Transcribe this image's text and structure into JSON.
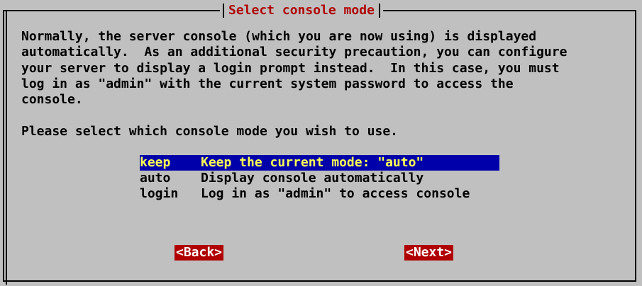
{
  "dialog": {
    "title": "Select console mode",
    "description_lines": [
      "Normally, the server console (which you are now using) is displayed",
      "automatically.  As an additional security precaution, you can configure",
      "your server to display a login prompt instead.  In this case, you must",
      "log in as \"admin\" with the current system password to access the",
      "console."
    ],
    "prompt": "Please select which console mode you wish to use.",
    "options": [
      {
        "tag": "keep",
        "label": "Keep the current mode: \"auto\"",
        "selected": true
      },
      {
        "tag": "auto",
        "label": "Display console automatically",
        "selected": false
      },
      {
        "tag": "login",
        "label": "Log in as \"admin\" to access console",
        "selected": false
      }
    ],
    "buttons": {
      "back_label": "<Back>",
      "next_label": "<Next>"
    }
  },
  "colors": {
    "background": "#c0c0c0",
    "title": "#b00000",
    "selected_bg": "#0000aa",
    "selected_fg": "#ffff55",
    "button_bg": "#b00000",
    "button_fg": "#ffffff"
  }
}
